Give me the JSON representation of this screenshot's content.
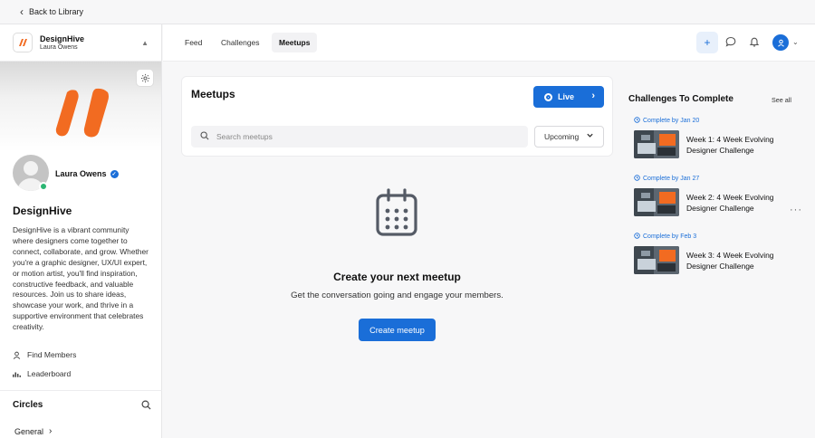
{
  "back_link": {
    "label": "Back to Library"
  },
  "community": {
    "name": "DesignHive",
    "owner": "Laura Owens",
    "description": "DesignHive is a vibrant community where designers come together to connect, collaborate, and grow. Whether you're a graphic designer, UX/UI expert, or motion artist, you'll find inspiration, constructive feedback, and valuable resources. Join us to share ideas, showcase your work, and thrive in a supportive environment that celebrates creativity.",
    "brand_color": "#f26b21"
  },
  "profile": {
    "name": "Laura Owens",
    "status_color": "#2bb673"
  },
  "sidebar": {
    "links": [
      {
        "label": "Find Members",
        "icon": "person-icon"
      },
      {
        "label": "Leaderboard",
        "icon": "bar-chart-icon"
      }
    ],
    "circles_title": "Circles",
    "circles": [
      {
        "label": "General"
      }
    ]
  },
  "topnav": {
    "tabs": [
      {
        "label": "Feed",
        "active": false
      },
      {
        "label": "Challenges",
        "active": false
      },
      {
        "label": "Meetups",
        "active": true
      }
    ]
  },
  "main": {
    "title": "Meetups",
    "live_label": "Live",
    "search_placeholder": "Search meetups",
    "filter_value": "Upcoming",
    "empty_title": "Create your next meetup",
    "empty_subtitle": "Get the conversation going and engage your members.",
    "create_label": "Create meetup"
  },
  "challenges": {
    "title": "Challenges To Complete",
    "see_all": "See all",
    "items": [
      {
        "due": "Complete by Jan 20",
        "name": "Week 1: 4 Week Evolving Designer Challenge"
      },
      {
        "due": "Complete by Jan 27",
        "name": "Week 2: 4 Week Evolving Designer Challenge"
      },
      {
        "due": "Complete by Feb 3",
        "name": "Week 3: 4 Week Evolving Designer Challenge"
      }
    ]
  },
  "colors": {
    "accent": "#1a6ed8"
  }
}
